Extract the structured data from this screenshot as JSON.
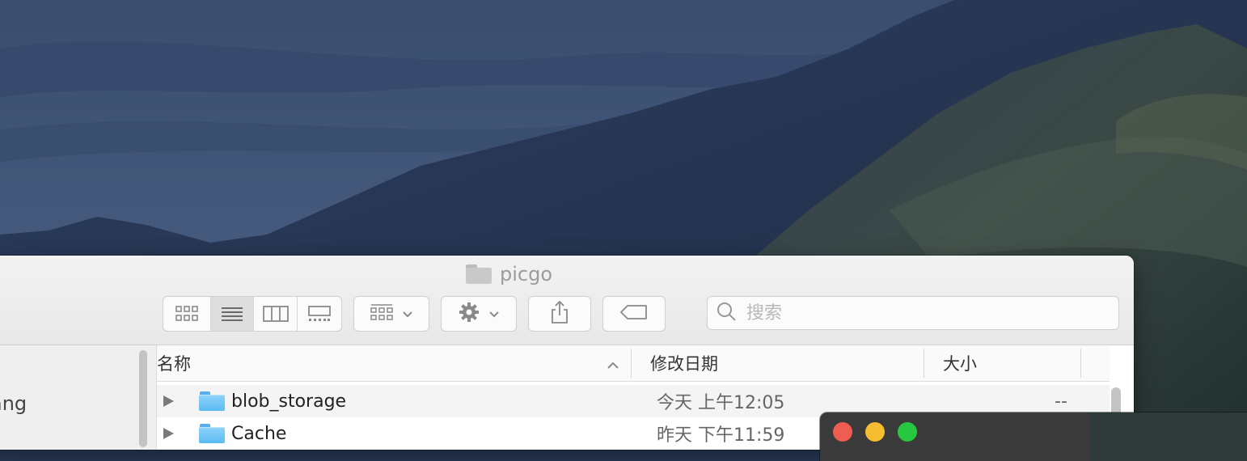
{
  "window": {
    "title": "picgo",
    "search_placeholder": "搜索",
    "sidebar_partial_text": "ang"
  },
  "toolbar": {
    "view_modes": [
      "icon-view-icon",
      "list-view-icon",
      "column-view-icon",
      "gallery-view-icon"
    ],
    "active_view": "list-view-icon"
  },
  "columns": {
    "name": "名称",
    "modified": "修改日期",
    "size": "大小"
  },
  "rows": [
    {
      "name": "blob_storage",
      "date": "今天 上午12:05",
      "size": "--"
    },
    {
      "name": "Cache",
      "date": "昨天 下午11:59",
      "size": ""
    }
  ],
  "colors": {
    "folder_blue": "#5cbaf2",
    "traffic_close": "#ee5c52",
    "traffic_minimize": "#f5bd2f",
    "traffic_zoom": "#27c73f"
  }
}
